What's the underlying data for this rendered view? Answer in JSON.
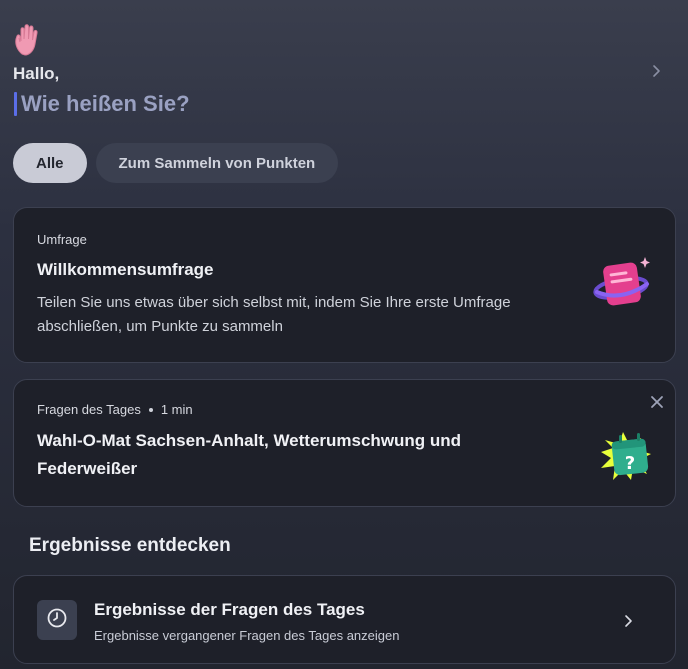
{
  "greeting": {
    "hello": "Hallo,",
    "name_placeholder": "Wie heißen Sie?",
    "icon": "raised-hand-icon"
  },
  "filters": [
    {
      "label": "Alle",
      "active": true
    },
    {
      "label": "Zum Sammeln von Punkten",
      "active": false
    }
  ],
  "cards": [
    {
      "kicker": "Umfrage",
      "title": "Willkommensumfrage",
      "description": "Teilen Sie uns etwas über sich selbst mit, indem Sie Ihre erste Umfrage abschließen, um Punkte zu sammeln",
      "icon": "survey-illustration-icon"
    },
    {
      "kicker": "Fragen des Tages",
      "duration": "1 min",
      "title": "Wahl-O-Mat Sachsen-Anhalt, Wetterumschwung und Federweißer",
      "icon": "question-calendar-illustration-icon"
    }
  ],
  "results": {
    "section_title": "Ergebnisse entdecken",
    "title": "Ergebnisse der Fragen des Tages",
    "subtitle": "Ergebnisse vergangener Fragen des Tages anzeigen",
    "icon": "clock-icon"
  },
  "colors": {
    "accent_caret": "#5b6ee8",
    "chip_active_bg": "#c9cbd6",
    "card_bg": "#1e2029"
  }
}
